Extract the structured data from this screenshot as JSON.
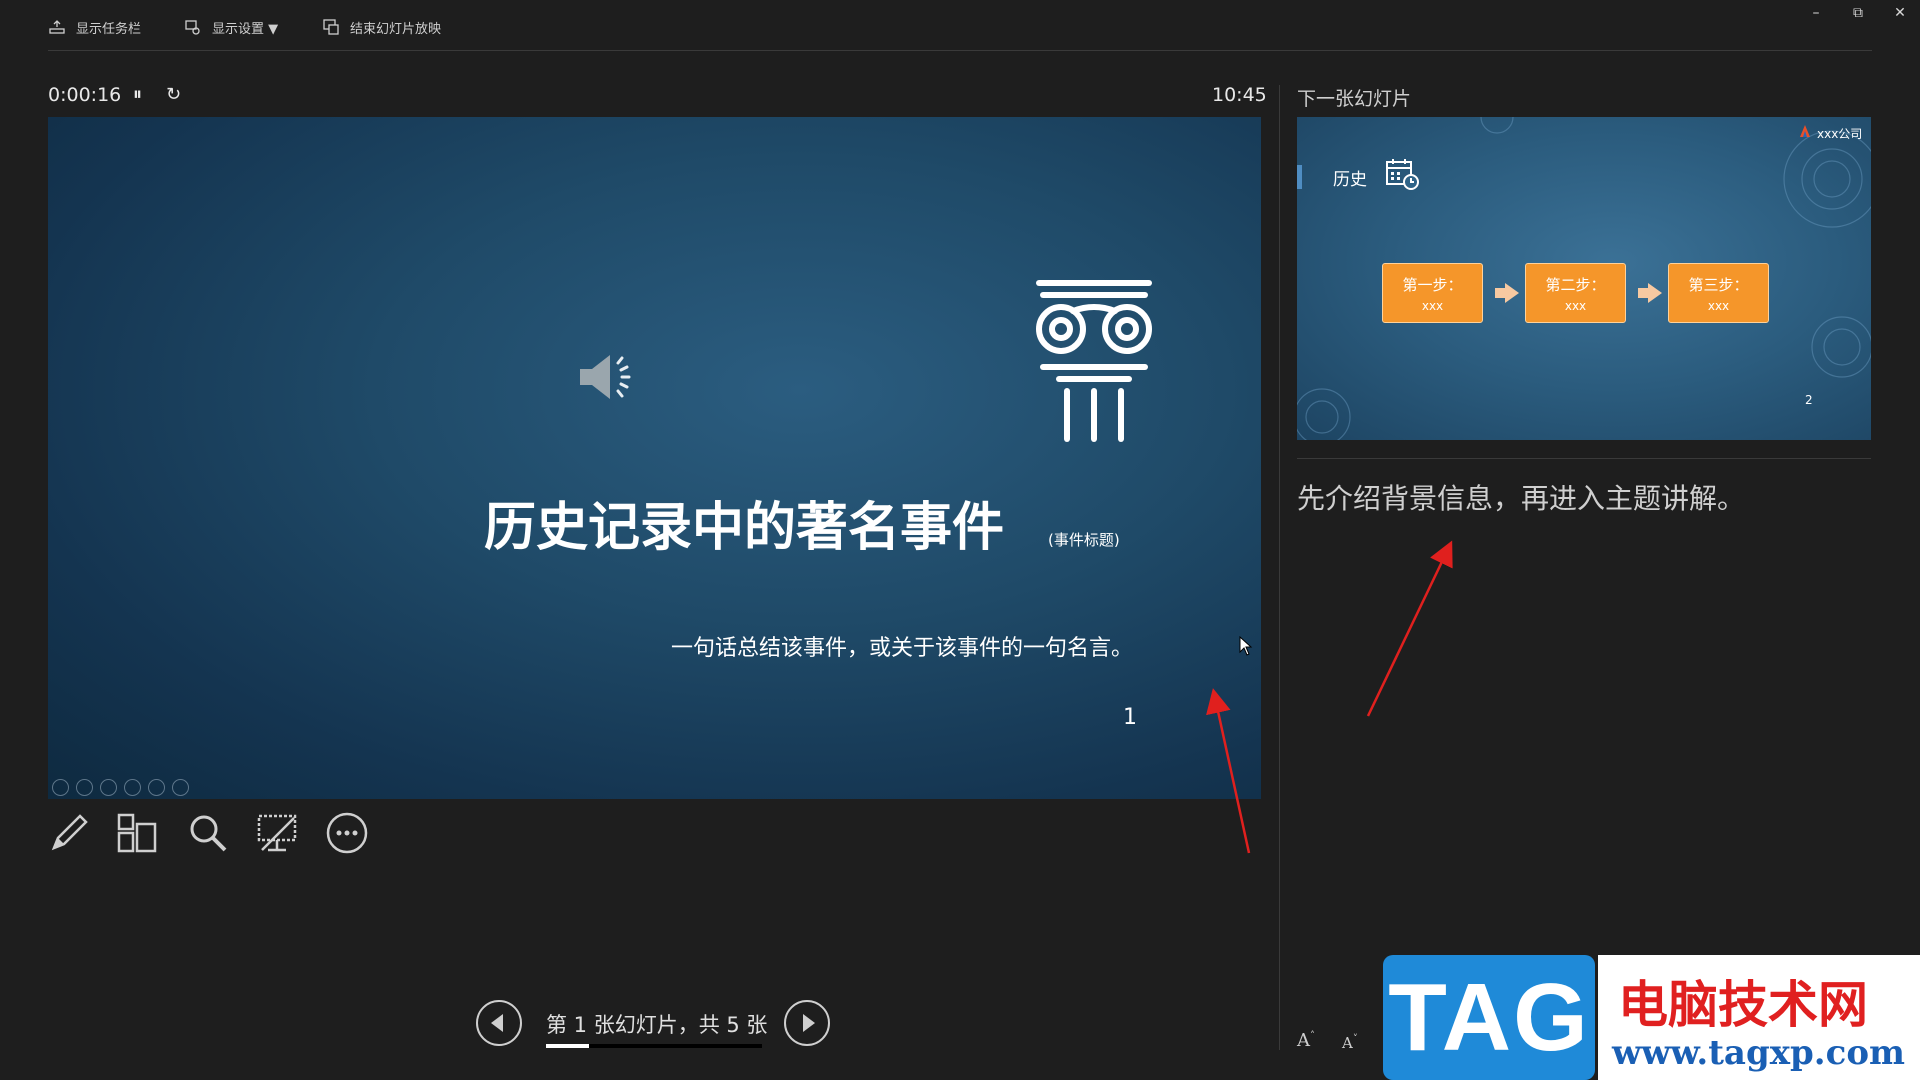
{
  "toolbar": {
    "show_taskbar": "显示任务栏",
    "display_settings": "显示设置 ▼",
    "end_show": "结束幻灯片放映"
  },
  "window": {
    "minimize": "–",
    "restore": "⧉",
    "close": "✕"
  },
  "presenter": {
    "timer": "0:00:16",
    "pause_icon": "pause-icon",
    "restart_icon": "restart-icon",
    "clock": "10:45"
  },
  "current_slide": {
    "title": "历史记录中的著名事件",
    "title_note": "(事件标题)",
    "subtitle": "一句话总结该事件，或关于该事件的一句名言。",
    "number": "1"
  },
  "tools": [
    "pen-tool-icon",
    "slide-grid-icon",
    "zoom-icon",
    "black-screen-icon",
    "more-options-icon"
  ],
  "navigation": {
    "label": "第 1 张幻灯片，共 5 张",
    "current": 1,
    "total": 5,
    "progress": 0.2
  },
  "next_slide": {
    "heading": "下一张幻灯片",
    "title": "历史",
    "logo_text": "xxx公司",
    "steps": [
      {
        "label": "第一步：",
        "value": "xxx"
      },
      {
        "label": "第二步：",
        "value": "xxx"
      },
      {
        "label": "第三步：",
        "value": "xxx"
      }
    ],
    "number": "2"
  },
  "notes": {
    "text": "先介绍背景信息，再进入主题讲解。"
  },
  "font_controls": {
    "increase": "A",
    "decrease": "A"
  },
  "watermark": {
    "tag": "TAG",
    "site_name": "电脑技术网",
    "url": "www.tagxp.com"
  }
}
